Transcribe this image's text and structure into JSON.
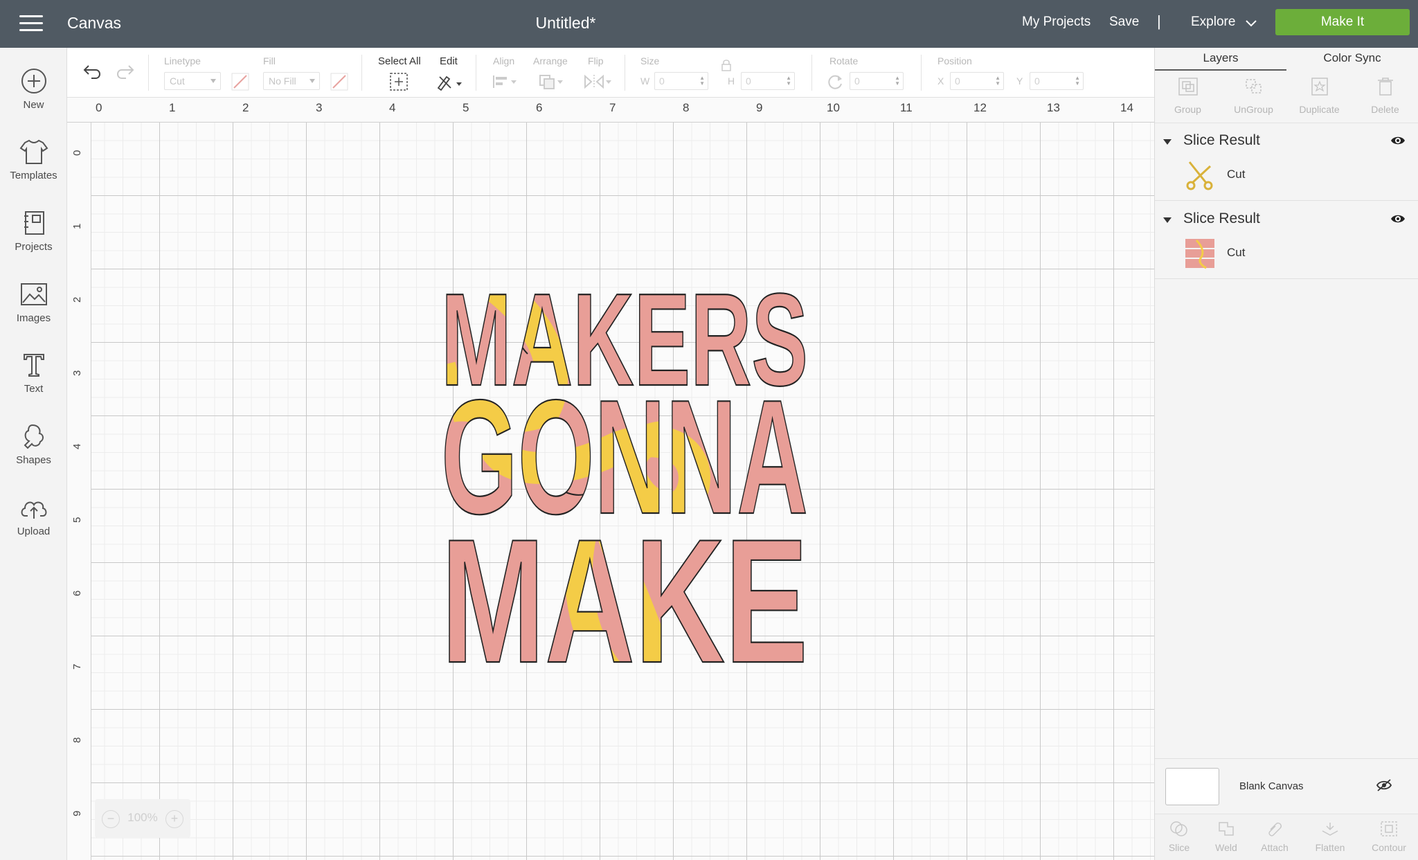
{
  "app": {
    "title": "Canvas",
    "document_title": "Untitled*"
  },
  "header": {
    "my_projects": "My Projects",
    "save": "Save",
    "separator": "|",
    "explore": "Explore",
    "make_it": "Make It",
    "make_it_color": "#6cae3a"
  },
  "sidebar": {
    "items": [
      {
        "label": "New",
        "icon": "plus-circle-icon"
      },
      {
        "label": "Templates",
        "icon": "tshirt-icon"
      },
      {
        "label": "Projects",
        "icon": "projects-icon"
      },
      {
        "label": "Images",
        "icon": "image-icon"
      },
      {
        "label": "Text",
        "icon": "text-icon"
      },
      {
        "label": "Shapes",
        "icon": "shapes-icon"
      },
      {
        "label": "Upload",
        "icon": "upload-cloud-icon"
      }
    ]
  },
  "toolbar": {
    "linetype_label": "Linetype",
    "linetype_value": "Cut",
    "fill_label": "Fill",
    "fill_value": "No Fill",
    "select_all": "Select All",
    "edit": "Edit",
    "align": "Align",
    "arrange": "Arrange",
    "flip": "Flip",
    "size": "Size",
    "w_label": "W",
    "w_value": "0",
    "h_label": "H",
    "h_value": "0",
    "rotate": "Rotate",
    "rotate_value": "0",
    "position": "Position",
    "x_label": "X",
    "x_value": "0",
    "y_label": "Y",
    "y_value": "0"
  },
  "canvas": {
    "ruler_x": [
      "0",
      "1",
      "2",
      "3",
      "4",
      "5",
      "6",
      "7",
      "8",
      "9",
      "10",
      "11",
      "12",
      "13",
      "14"
    ],
    "ruler_y": [
      "0",
      "1",
      "2",
      "3",
      "4",
      "5",
      "6",
      "7",
      "8",
      "9"
    ],
    "zoom": "100%",
    "design_colors": {
      "pink": "#e89e97",
      "yellow": "#f4cc47",
      "outline": "#222222"
    }
  },
  "panel": {
    "tabs": [
      "Layers",
      "Color Sync"
    ],
    "tools": [
      "Group",
      "UnGroup",
      "Duplicate",
      "Delete"
    ],
    "layers": [
      {
        "title": "Slice Result",
        "item": "Cut",
        "thumb": "scissors-icon"
      },
      {
        "title": "Slice Result",
        "item": "Cut",
        "thumb": "design-thumbnail"
      }
    ],
    "blank_canvas": "Blank Canvas",
    "bottom_tools": [
      "Slice",
      "Weld",
      "Attach",
      "Flatten",
      "Contour"
    ]
  }
}
